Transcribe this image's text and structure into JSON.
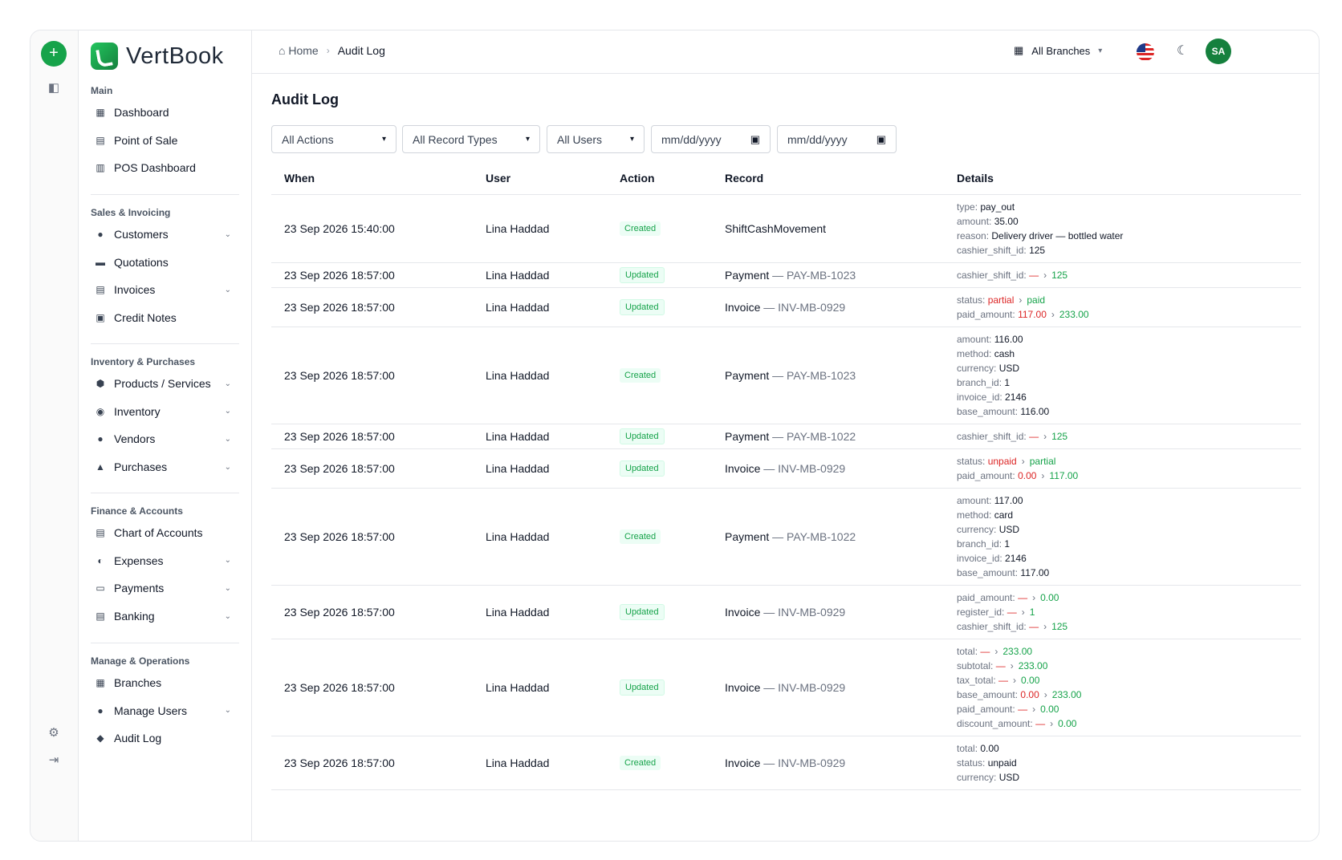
{
  "app": {
    "name": "VertBook"
  },
  "sidebar": {
    "sections": [
      {
        "title": "Main",
        "items": [
          {
            "label": "Dashboard",
            "icon": "grid-icon",
            "chevron": false
          },
          {
            "label": "Point of Sale",
            "icon": "register-icon",
            "chevron": false
          },
          {
            "label": "POS Dashboard",
            "icon": "bar-chart-icon",
            "chevron": false
          }
        ]
      },
      {
        "title": "Sales & Invoicing",
        "items": [
          {
            "label": "Customers",
            "icon": "users-icon",
            "chevron": true
          },
          {
            "label": "Quotations",
            "icon": "quote-icon",
            "chevron": false
          },
          {
            "label": "Invoices",
            "icon": "invoice-icon",
            "chevron": true
          },
          {
            "label": "Credit Notes",
            "icon": "credit-note-icon",
            "chevron": false
          }
        ]
      },
      {
        "title": "Inventory & Purchases",
        "items": [
          {
            "label": "Products / Services",
            "icon": "box-icon",
            "chevron": true
          },
          {
            "label": "Inventory",
            "icon": "inventory-icon",
            "chevron": true
          },
          {
            "label": "Vendors",
            "icon": "vendors-icon",
            "chevron": true
          },
          {
            "label": "Purchases",
            "icon": "bag-icon",
            "chevron": true
          }
        ]
      },
      {
        "title": "Finance & Accounts",
        "items": [
          {
            "label": "Chart of Accounts",
            "icon": "ledger-icon",
            "chevron": false
          },
          {
            "label": "Expenses",
            "icon": "expense-icon",
            "chevron": true
          },
          {
            "label": "Payments",
            "icon": "payment-icon",
            "chevron": true
          },
          {
            "label": "Banking",
            "icon": "bank-icon",
            "chevron": true
          }
        ]
      },
      {
        "title": "Manage & Operations",
        "items": [
          {
            "label": "Branches",
            "icon": "branch-icon",
            "chevron": false
          },
          {
            "label": "Manage Users",
            "icon": "manage-users-icon",
            "chevron": true
          },
          {
            "label": "Audit Log",
            "icon": "audit-icon",
            "chevron": false
          }
        ]
      }
    ]
  },
  "breadcrumb": {
    "home": "Home",
    "current": "Audit Log"
  },
  "topbar": {
    "branch": "All Branches",
    "avatar": "SA"
  },
  "page": {
    "title": "Audit Log"
  },
  "filters": {
    "actions": "All Actions",
    "record_types": "All Record Types",
    "users": "All Users",
    "date_from": "mm/dd/yyyy",
    "date_to": "mm/dd/yyyy"
  },
  "table": {
    "headers": [
      "When",
      "User",
      "Action",
      "Record",
      "Details"
    ],
    "rows": [
      {
        "when": "23 Sep 2026 15:40:00",
        "user": "Lina Haddad",
        "action": "Created",
        "record": "ShiftCashMovement",
        "record_ref": "",
        "details": [
          {
            "k": "type",
            "v": "pay_out"
          },
          {
            "k": "amount",
            "v": "35.00"
          },
          {
            "k": "reason",
            "v": "Delivery driver — bottled water"
          },
          {
            "k": "cashier_shift_id",
            "v": "125"
          }
        ]
      },
      {
        "when": "23 Sep 2026 18:57:00",
        "user": "Lina Haddad",
        "action": "Updated",
        "record": "Payment",
        "record_ref": "PAY-MB-1023",
        "details": [
          {
            "k": "cashier_shift_id",
            "old": "—",
            "new": "125"
          }
        ]
      },
      {
        "when": "23 Sep 2026 18:57:00",
        "user": "Lina Haddad",
        "action": "Updated",
        "record": "Invoice",
        "record_ref": "INV-MB-0929",
        "details": [
          {
            "k": "status",
            "old": "partial",
            "new": "paid"
          },
          {
            "k": "paid_amount",
            "old": "117.00",
            "new": "233.00"
          }
        ]
      },
      {
        "when": "23 Sep 2026 18:57:00",
        "user": "Lina Haddad",
        "action": "Created",
        "record": "Payment",
        "record_ref": "PAY-MB-1023",
        "details": [
          {
            "k": "amount",
            "v": "116.00"
          },
          {
            "k": "method",
            "v": "cash"
          },
          {
            "k": "currency",
            "v": "USD"
          },
          {
            "k": "branch_id",
            "v": "1"
          },
          {
            "k": "invoice_id",
            "v": "2146"
          },
          {
            "k": "base_amount",
            "v": "116.00"
          }
        ]
      },
      {
        "when": "23 Sep 2026 18:57:00",
        "user": "Lina Haddad",
        "action": "Updated",
        "record": "Payment",
        "record_ref": "PAY-MB-1022",
        "details": [
          {
            "k": "cashier_shift_id",
            "old": "—",
            "new": "125"
          }
        ]
      },
      {
        "when": "23 Sep 2026 18:57:00",
        "user": "Lina Haddad",
        "action": "Updated",
        "record": "Invoice",
        "record_ref": "INV-MB-0929",
        "details": [
          {
            "k": "status",
            "old": "unpaid",
            "new": "partial"
          },
          {
            "k": "paid_amount",
            "old": "0.00",
            "new": "117.00"
          }
        ]
      },
      {
        "when": "23 Sep 2026 18:57:00",
        "user": "Lina Haddad",
        "action": "Created",
        "record": "Payment",
        "record_ref": "PAY-MB-1022",
        "details": [
          {
            "k": "amount",
            "v": "117.00"
          },
          {
            "k": "method",
            "v": "card"
          },
          {
            "k": "currency",
            "v": "USD"
          },
          {
            "k": "branch_id",
            "v": "1"
          },
          {
            "k": "invoice_id",
            "v": "2146"
          },
          {
            "k": "base_amount",
            "v": "117.00"
          }
        ]
      },
      {
        "when": "23 Sep 2026 18:57:00",
        "user": "Lina Haddad",
        "action": "Updated",
        "record": "Invoice",
        "record_ref": "INV-MB-0929",
        "details": [
          {
            "k": "paid_amount",
            "old": "—",
            "new": "0.00"
          },
          {
            "k": "register_id",
            "old": "—",
            "new": "1"
          },
          {
            "k": "cashier_shift_id",
            "old": "—",
            "new": "125"
          }
        ]
      },
      {
        "when": "23 Sep 2026 18:57:00",
        "user": "Lina Haddad",
        "action": "Updated",
        "record": "Invoice",
        "record_ref": "INV-MB-0929",
        "details": [
          {
            "k": "total",
            "old": "—",
            "new": "233.00"
          },
          {
            "k": "subtotal",
            "old": "—",
            "new": "233.00"
          },
          {
            "k": "tax_total",
            "old": "—",
            "new": "0.00"
          },
          {
            "k": "base_amount",
            "old": "0.00",
            "new": "233.00"
          },
          {
            "k": "paid_amount",
            "old": "—",
            "new": "0.00"
          },
          {
            "k": "discount_amount",
            "old": "—",
            "new": "0.00"
          }
        ]
      },
      {
        "when": "23 Sep 2026 18:57:00",
        "user": "Lina Haddad",
        "action": "Created",
        "record": "Invoice",
        "record_ref": "INV-MB-0929",
        "details": [
          {
            "k": "total",
            "v": "0.00"
          },
          {
            "k": "status",
            "v": "unpaid"
          },
          {
            "k": "currency",
            "v": "USD"
          }
        ]
      }
    ]
  }
}
